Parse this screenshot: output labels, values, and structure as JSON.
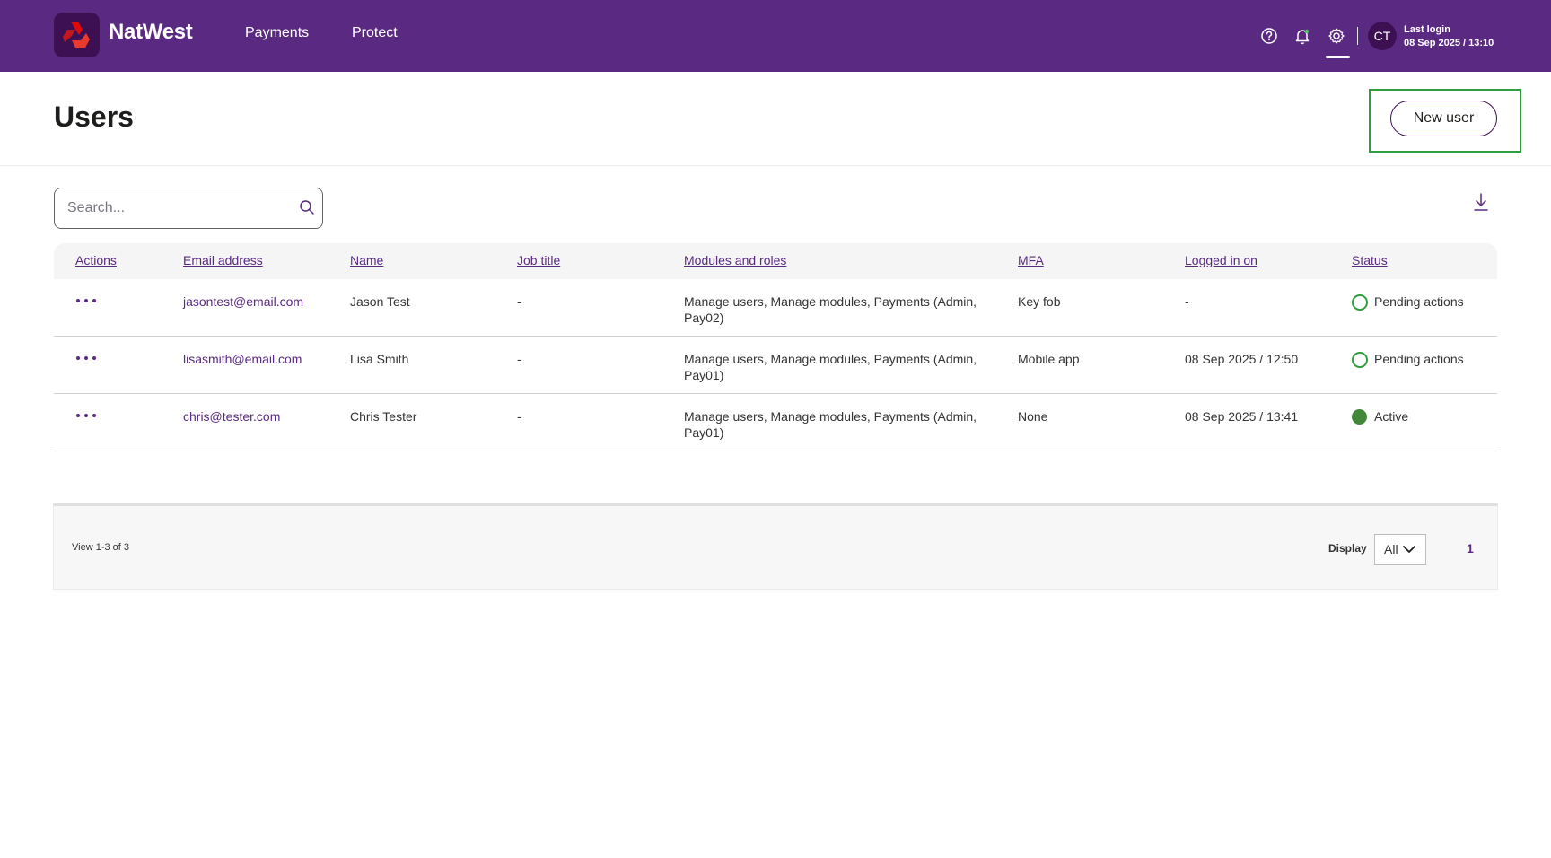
{
  "header": {
    "brand": "NatWest",
    "nav": [
      "Payments",
      "Protect"
    ],
    "avatar_initials": "CT",
    "last_login_label": "Last login",
    "last_login_value": "08 Sep 2025 / 13:10",
    "icons": [
      "help-icon",
      "bell-icon",
      "gear-icon"
    ],
    "bar_color": "#5a2a82"
  },
  "page": {
    "title": "Users",
    "new_user_label": "New user"
  },
  "search": {
    "placeholder": "Search...",
    "value": ""
  },
  "table": {
    "columns": [
      "Actions",
      "Email address",
      "Name",
      "Job title",
      "Modules and roles",
      "MFA",
      "Logged in on",
      "Status"
    ],
    "rows": [
      {
        "email": "jasontest@email.com",
        "name": "Jason Test",
        "job_title": "-",
        "modules": "Manage users, Manage modules, Payments (Admin, Pay02)",
        "mfa": "Key fob",
        "logged_in_on": "-",
        "status": "Pending actions",
        "status_kind": "pending"
      },
      {
        "email": "lisasmith@email.com",
        "name": "Lisa Smith",
        "job_title": "-",
        "modules": "Manage users, Manage modules, Payments (Admin, Pay01)",
        "mfa": "Mobile app",
        "logged_in_on": "08 Sep 2025 / 12:50",
        "status": "Pending actions",
        "status_kind": "pending"
      },
      {
        "email": "chris@tester.com",
        "name": "Chris Tester",
        "job_title": "-",
        "modules": "Manage users, Manage modules, Payments (Admin, Pay01)",
        "mfa": "None",
        "logged_in_on": "08 Sep 2025 / 13:41",
        "status": "Active",
        "status_kind": "active"
      }
    ]
  },
  "pager": {
    "view_text": "View 1-3 of 3",
    "display_label": "Display",
    "display_value": "All",
    "current_page": "1"
  }
}
